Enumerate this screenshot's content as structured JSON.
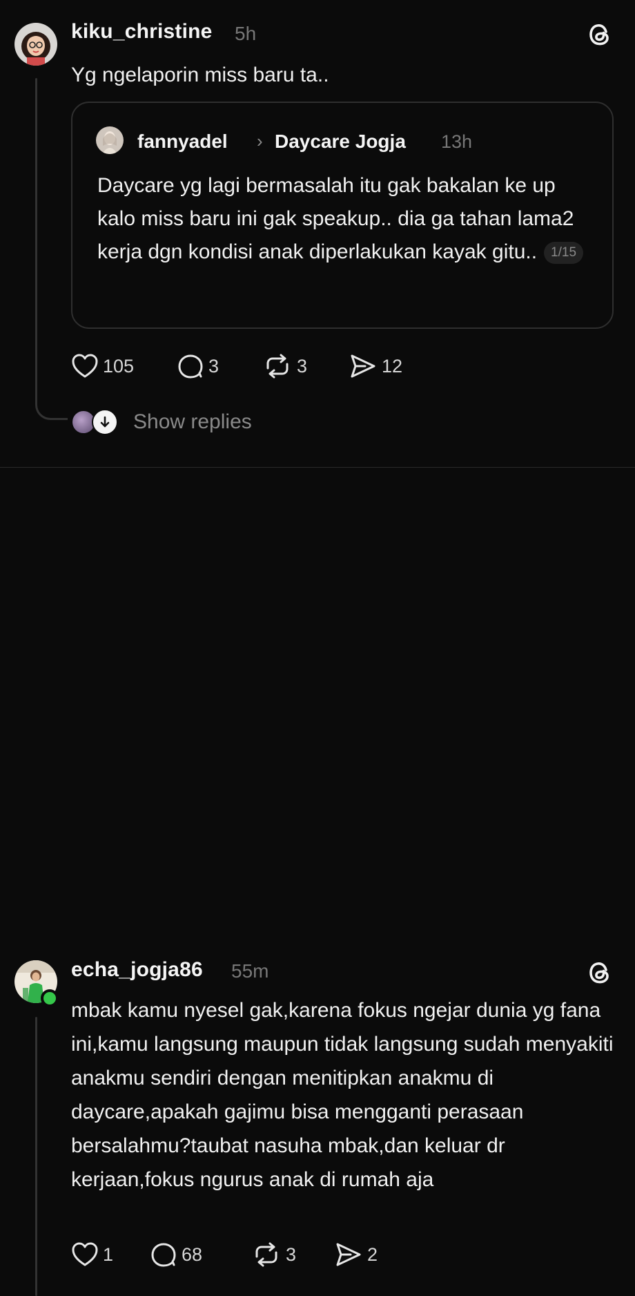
{
  "posts": [
    {
      "username": "kiku_christine",
      "time": "5h",
      "text": "Yg ngelaporin miss baru ta..",
      "quote": {
        "username": "fannyadel",
        "group": "Daycare Jogja",
        "time": "13h",
        "text": "Daycare yg lagi bermasalah itu gak bakalan ke up kalo miss baru ini gak speakup.. dia ga tahan lama2 kerja dgn kondisi anak diperlakukan kayak gitu..",
        "page_badge": "1/15"
      },
      "likes": "105",
      "comments": "3",
      "reposts": "3",
      "shares": "12",
      "show_replies": "Show replies"
    },
    {
      "username": "echa_jogja86",
      "time": "55m",
      "text": "mbak kamu nyesel gak,karena fokus ngejar dunia yg fana ini,kamu langsung maupun tidak langsung sudah menyakiti anakmu sendiri dengan menitipkan anakmu di daycare,apakah gajimu bisa mengganti perasaan bersalahmu?taubat nasuha mbak,dan keluar dr kerjaan,fokus ngurus anak di rumah aja",
      "likes": "1",
      "comments": "68",
      "reposts": "3",
      "shares": "2"
    }
  ],
  "icons": {
    "logo": "threads-logo-icon",
    "like": "heart-icon",
    "comment": "comment-bubble-icon",
    "repost": "repost-icon",
    "share": "send-icon",
    "expand": "arrow-down-icon"
  },
  "colors": {
    "background": "#0b0b0b",
    "online": "#35c84a",
    "muted": "#777777"
  }
}
